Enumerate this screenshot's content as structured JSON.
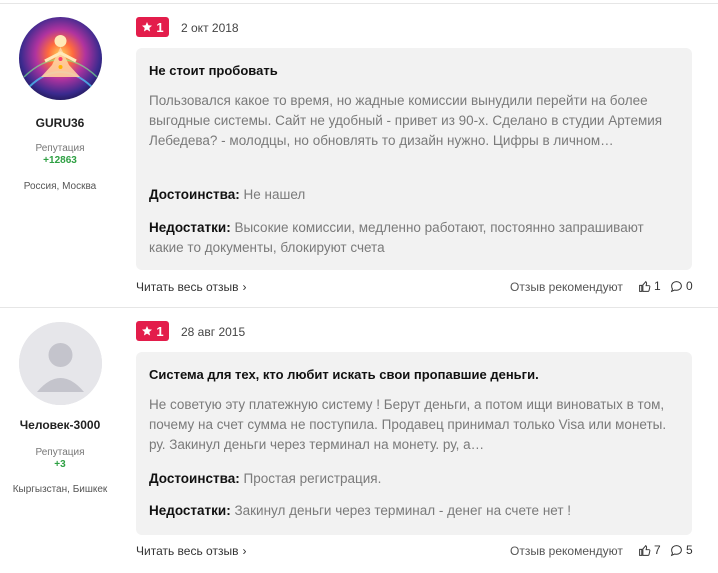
{
  "reviews": [
    {
      "username": "GURU36",
      "reputation_label": "Репутация",
      "reputation_value": "+12863",
      "location": "Россия, Москва",
      "rating": "1",
      "date": "2 окт 2018",
      "title": "Не стоит пробовать",
      "text": "Пользовался какое то время, но жадные комиссии вынудили перейти на более выгодные системы. Сайт не удобный - привет из 90-х. Сделано в студии Артемия Лебедева? - молодцы, но обновлять то дизайн нужно. Цифры в личном…",
      "pros_label": "Достоинства:",
      "pros": "Не нашел",
      "cons_label": "Недостатки:",
      "cons": "Высокие комиссии, медленно работают, постоянно запрашивают какие то документы, блокируют счета",
      "read_more": "Читать весь отзыв",
      "recommend": "Отзыв рекомендуют",
      "likes": "1",
      "comments": "0",
      "avatar": "meditation-avatar"
    },
    {
      "username": "Человек-3000",
      "reputation_label": "Репутация",
      "reputation_value": "+3",
      "location": "Кыргызстан, Бишкек",
      "rating": "1",
      "date": "28 авг 2015",
      "title": "Система для тех, кто любит искать свои пропавшие деньги.",
      "text": "Не советую эту платежную систему ! Берут деньги, а потом ищи виноватых в том, почему на счет сумма не поступила. Продавец принимал только Visa или монеты. ру. Закинул деньги через терминал на монету. ру, а…",
      "pros_label": "Достоинства:",
      "pros": "Простая регистрация.",
      "cons_label": "Недостатки:",
      "cons": "Закинул деньги через терминал - денег на счете нет !",
      "read_more": "Читать весь отзыв",
      "recommend": "Отзыв рекомендуют",
      "likes": "7",
      "comments": "5",
      "avatar": "default-user-avatar"
    }
  ],
  "colors": {
    "badge": "#e31d4b",
    "reputation": "#2ea043",
    "card": "#f2f2f2"
  }
}
